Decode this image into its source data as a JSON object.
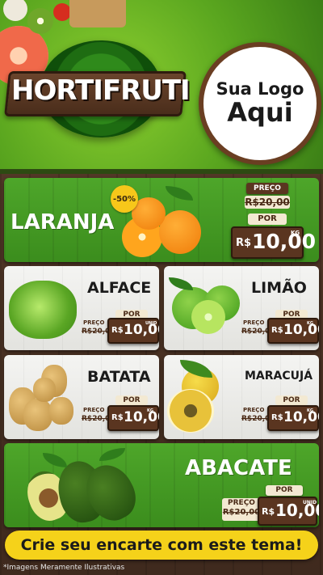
{
  "header": {
    "brand": "HORTIFRUTI",
    "logo_line1": "Sua Logo",
    "logo_line2": "Aqui"
  },
  "products": {
    "laranja": {
      "name": "LARANJA",
      "badge": "-50%",
      "from_label": "PREÇO",
      "old_price": "R$20,00",
      "por_label": "POR",
      "currency": "R$",
      "price": "10,00",
      "unit": "KG"
    },
    "alface": {
      "name": "ALFACE",
      "from_label": "PREÇO",
      "old_price": "R$20,00",
      "por_label": "POR",
      "currency": "R$",
      "price": "10,00",
      "unit": "UNID"
    },
    "limao": {
      "name": "LIMÃO",
      "from_label": "PREÇO",
      "old_price": "R$20,00",
      "por_label": "POR",
      "currency": "R$",
      "price": "10,00",
      "unit": "KG"
    },
    "batata": {
      "name": "BATATA",
      "from_label": "PREÇO",
      "old_price": "R$20,00",
      "por_label": "POR",
      "currency": "R$",
      "price": "10,00",
      "unit": "KG"
    },
    "maracuja": {
      "name": "MARACUJÁ",
      "from_label": "PREÇO",
      "old_price": "R$20,00",
      "por_label": "POR",
      "currency": "R$",
      "price": "10,00",
      "unit": "KG"
    },
    "abacate": {
      "name": "ABACATE",
      "from_label": "PREÇO",
      "old_price": "R$20,00",
      "por_label": "POR",
      "currency": "R$",
      "price": "10,00",
      "unit": "UNID"
    }
  },
  "banner": "Crie seu encarte com este tema!",
  "disclaimer": "*Imagens Meramente Ilustrativas",
  "colors": {
    "green": "#4ea62a",
    "wood": "#5a3520",
    "yellow": "#f5d21a"
  }
}
